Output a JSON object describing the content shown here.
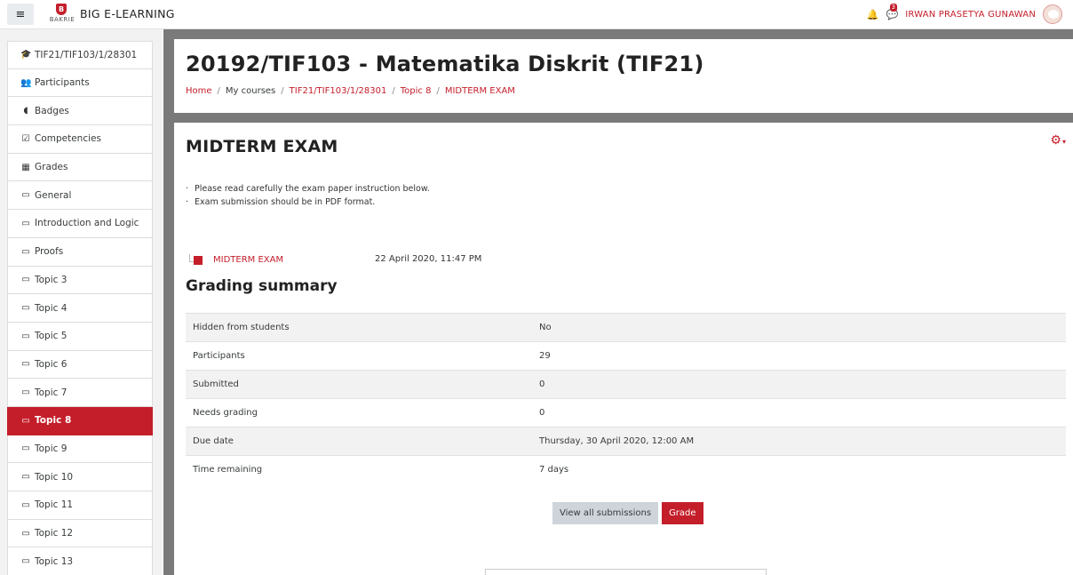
{
  "navbar": {
    "logo_text": "BAKRIE",
    "site_name": "BIG E-LEARNING",
    "message_count": "3",
    "user_name": "IRWAN PRASETYA GUNAWAN"
  },
  "drawer": {
    "items": [
      {
        "icon": "graduation-cap-icon",
        "glyph": "🎓",
        "label": "TIF21/TIF103/1/28301"
      },
      {
        "icon": "users-icon",
        "glyph": "👥",
        "label": "Participants"
      },
      {
        "icon": "shield-icon",
        "glyph": "◖",
        "label": "Badges"
      },
      {
        "icon": "check-square-icon",
        "glyph": "☑",
        "label": "Competencies"
      },
      {
        "icon": "table-icon",
        "glyph": "▦",
        "label": "Grades"
      },
      {
        "icon": "folder-icon",
        "glyph": "▭",
        "label": "General"
      },
      {
        "icon": "folder-icon",
        "glyph": "▭",
        "label": "Introduction and Logic"
      },
      {
        "icon": "folder-icon",
        "glyph": "▭",
        "label": "Proofs"
      },
      {
        "icon": "folder-icon",
        "glyph": "▭",
        "label": "Topic 3"
      },
      {
        "icon": "folder-icon",
        "glyph": "▭",
        "label": "Topic 4"
      },
      {
        "icon": "folder-icon",
        "glyph": "▭",
        "label": "Topic 5"
      },
      {
        "icon": "folder-icon",
        "glyph": "▭",
        "label": "Topic 6"
      },
      {
        "icon": "folder-icon",
        "glyph": "▭",
        "label": "Topic 7"
      },
      {
        "icon": "folder-icon",
        "glyph": "▭",
        "label": "Topic 8"
      },
      {
        "icon": "folder-icon",
        "glyph": "▭",
        "label": "Topic 9"
      },
      {
        "icon": "folder-icon",
        "glyph": "▭",
        "label": "Topic 10"
      },
      {
        "icon": "folder-icon",
        "glyph": "▭",
        "label": "Topic 11"
      },
      {
        "icon": "folder-icon",
        "glyph": "▭",
        "label": "Topic 12"
      },
      {
        "icon": "folder-icon",
        "glyph": "▭",
        "label": "Topic 13"
      }
    ],
    "active_label": "Topic 8"
  },
  "header": {
    "course_title": "20192/TIF103 - Matematika Diskrit (TIF21)",
    "breadcrumb": [
      "Home",
      "My courses",
      "TIF21/TIF103/1/28301",
      "Topic 8",
      "MIDTERM EXAM"
    ]
  },
  "main": {
    "heading": "MIDTERM EXAM",
    "instructions": [
      "Please read carefully the exam paper instruction below.",
      "Exam submission should be in PDF format."
    ],
    "file": {
      "name": "MIDTERM EXAM",
      "date": "22 April 2020, 11:47 PM"
    },
    "grading_title": "Grading summary",
    "grading_rows": [
      {
        "label": "Hidden from students",
        "value": "No"
      },
      {
        "label": "Participants",
        "value": "29"
      },
      {
        "label": "Submitted",
        "value": "0"
      },
      {
        "label": "Needs grading",
        "value": "0"
      },
      {
        "label": "Due date",
        "value": "Thursday, 30 April 2020, 12:00 AM"
      },
      {
        "label": "Time remaining",
        "value": "7 days"
      }
    ],
    "buttons": {
      "view_all": "View all submissions",
      "grade": "Grade"
    }
  },
  "colors": {
    "accent": "#c41e2a",
    "drawer_bg": "#f2f2f2",
    "page_bg": "#7a7a7a"
  }
}
